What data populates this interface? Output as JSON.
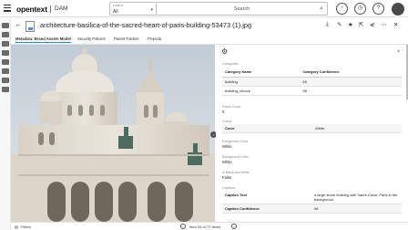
{
  "header": {
    "logo": "opentext",
    "product": "DAM",
    "look_in_label": "Look In",
    "look_in_value": "All",
    "search_placeholder": "Search"
  },
  "file": {
    "title": "architecture-basilica-of-the-sacred-heart-of-paris-building-53473 (1).jpg"
  },
  "tabs": [
    "Metadata: Brand Assets Model",
    "Security Policies",
    "Parent Folders",
    "Projects"
  ],
  "panel": {
    "categories_label": "Categories",
    "categories_table": {
      "headers": [
        "Category Name",
        "Category Confidence"
      ],
      "rows": [
        [
          "building",
          "26"
        ],
        [
          "building_church",
          "98"
        ]
      ]
    },
    "faces_label": "Faces Count",
    "faces_value": "0",
    "colors_label": "Colors",
    "colors_table": {
      "headers": [
        "Color",
        "White"
      ]
    },
    "foreground_label": "Foreground Color",
    "foreground_value": "White",
    "background_label": "Background Color",
    "background_value": "White",
    "accent_label": "Is Black and White",
    "accent_value": "False",
    "captions_label": "Captions",
    "captions_table": {
      "rows": [
        [
          "Caption Text",
          "a large stone building with Sacré-Cœur, Paris in the background"
        ],
        [
          "Caption Confidence",
          "98"
        ]
      ]
    }
  },
  "footer": {
    "filters": "Filters",
    "item_counter": "Item 34 of 72 Items"
  },
  "colors": {
    "accent": "#1e88e5"
  }
}
